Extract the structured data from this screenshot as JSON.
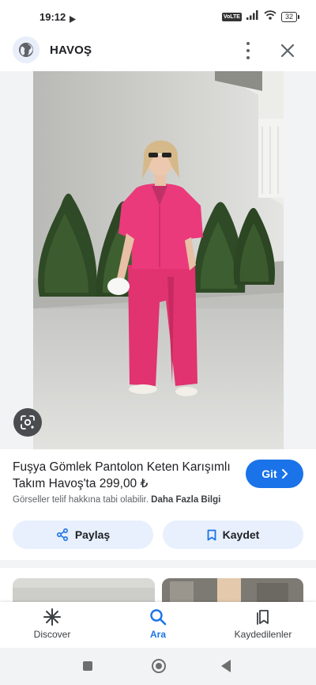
{
  "status_bar": {
    "time": "19:12",
    "battery": "32",
    "network": "VoLTE"
  },
  "header": {
    "site_name": "HAVOŞ"
  },
  "product": {
    "title": "Fuşya Gömlek Pantolon Keten Karışımlı Takım Havoş'ta 299,00 ₺",
    "go_label": "Git",
    "copyright_text": "Görseller telif hakkına tabi olabilir.",
    "more_info_label": "Daha Fazla Bilgi"
  },
  "actions": {
    "share_label": "Paylaş",
    "save_label": "Kaydet"
  },
  "bottom_nav": {
    "items": [
      {
        "label": "Discover",
        "icon": "asterisk-icon",
        "active": false
      },
      {
        "label": "Ara",
        "icon": "search-icon",
        "active": true
      },
      {
        "label": "Kaydedilenler",
        "icon": "bookmarks-icon",
        "active": false
      }
    ]
  },
  "colors": {
    "accent": "#1a73e8",
    "chip_bg": "#e8f0fe",
    "outfit": "#e8367a"
  }
}
